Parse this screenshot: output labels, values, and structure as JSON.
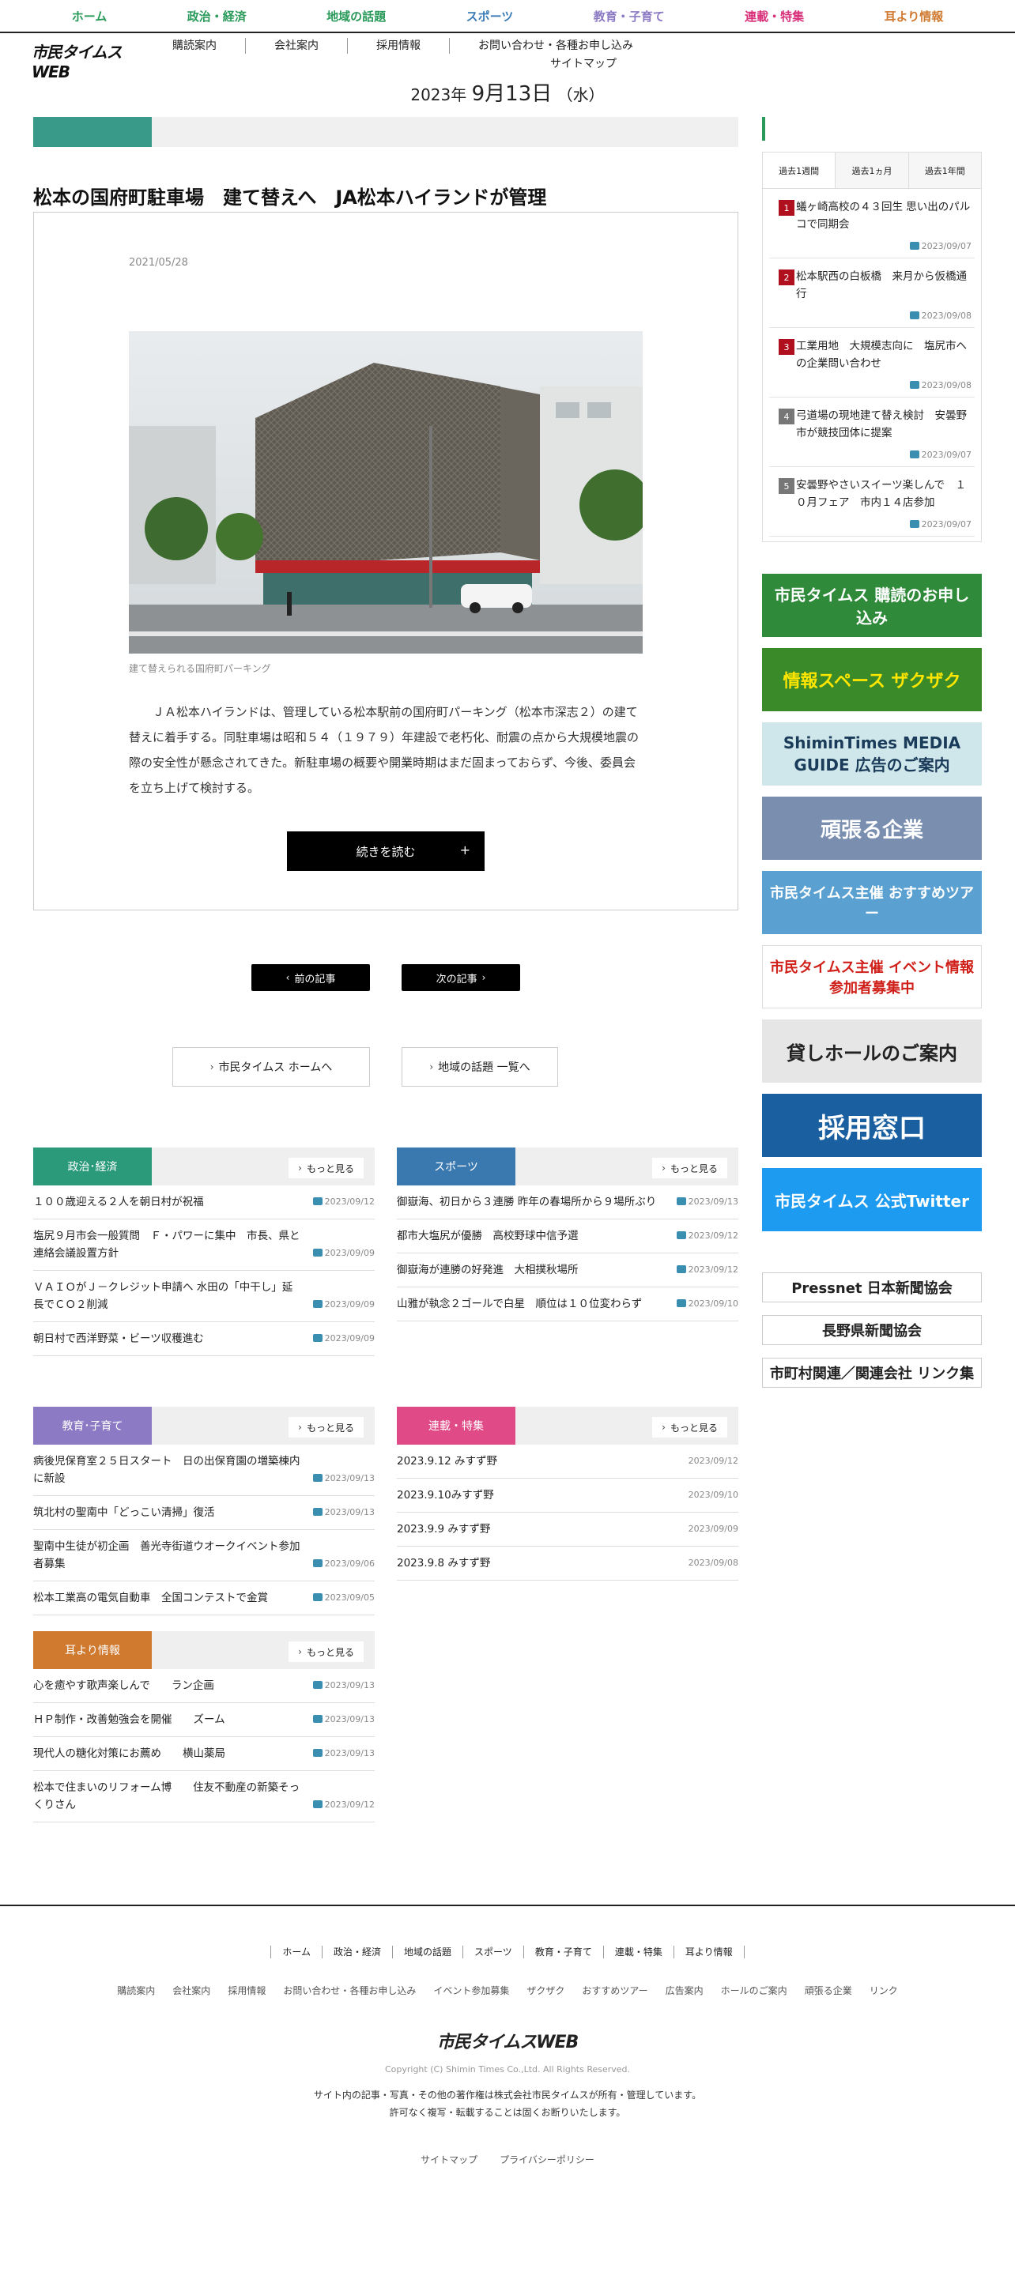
{
  "topnav": [
    {
      "label": "ホーム",
      "color": "#2a9a5a"
    },
    {
      "label": "政治・経済",
      "color": "#2a9a5a"
    },
    {
      "label": "地域の話題",
      "color": "#2a9a5a"
    },
    {
      "label": "スポーツ",
      "color": "#3a7ab5"
    },
    {
      "label": "教育・子育て",
      "color": "#8c7bc4"
    },
    {
      "label": "連載・特集",
      "color": "#d8307a"
    },
    {
      "label": "耳より情報",
      "color": "#d07a30"
    }
  ],
  "logo": "市民タイムスWEB",
  "subnav": [
    "購読案内",
    "会社案内",
    "採用情報",
    "お問い合わせ・各種お申し込み"
  ],
  "subnav2": "サイトマップ",
  "date": {
    "year": "2023",
    "year_suffix": "年",
    "md": "9月13日",
    "weekday": "（水）"
  },
  "article": {
    "title": "松本の国府町駐車場　建て替えへ　JA松本ハイランドが管理",
    "date": "2021/05/28",
    "caption": "建て替えられる国府町パーキング",
    "body": "ＪＡ松本ハイランドは、管理している松本駅前の国府町パーキング（松本市深志２）の建て替えに着手する。同駐車場は昭和５４（１９７９）年建設で老朽化、耐震の点から大規模地震の際の安全性が懸念されてきた。新駐車場の概要や開業時期はまだ固まっておらず、今後、委員会を立ち上げて検討する。",
    "more": "続きを読む"
  },
  "pager": {
    "prev": "前の記事",
    "next": "次の記事"
  },
  "links": {
    "home": "市民タイムス ホームへ",
    "list": "地域の話題 一覧へ"
  },
  "more_label": "もっと見る",
  "sections": {
    "politics": {
      "label": "政治･経済",
      "color": "#2a9a7a",
      "items": [
        {
          "title": "１００歳迎える２人を朝日村が祝福",
          "date": "2023/09/12",
          "cam": true
        },
        {
          "title": "塩尻９月市会一般質問　Ｆ・パワーに集中　市長、県と連絡会議設置方針",
          "date": "2023/09/09",
          "cam": true
        },
        {
          "title": "ＶＡＩＯがＪ－クレジット申請へ 水田の「中干し」延長でＣＯ２削減",
          "date": "2023/09/09",
          "cam": true
        },
        {
          "title": "朝日村で西洋野菜・ビーツ収穫進む",
          "date": "2023/09/09",
          "cam": true
        }
      ]
    },
    "sports": {
      "label": "スポーツ",
      "color": "#3a78b0",
      "items": [
        {
          "title": "御嶽海、初日から３連勝 昨年の春場所から９場所ぶり",
          "date": "2023/09/13",
          "cam": true
        },
        {
          "title": "都市大塩尻が優勝　高校野球中信予選",
          "date": "2023/09/12",
          "cam": true
        },
        {
          "title": "御嶽海が連勝の好発進　大相撲秋場所",
          "date": "2023/09/12",
          "cam": true
        },
        {
          "title": "山雅が執念２ゴールで白星　順位は１０位変わらず",
          "date": "2023/09/10",
          "cam": true
        }
      ]
    },
    "education": {
      "label": "教育･子育て",
      "color": "#8c7bc4",
      "items": [
        {
          "title": "病後児保育室２５日スタート　日の出保育園の増築棟内に新設",
          "date": "2023/09/13",
          "cam": true
        },
        {
          "title": "筑北村の聖南中「どっこい清掃」復活",
          "date": "2023/09/13",
          "cam": true
        },
        {
          "title": "聖南中生徒が初企画　善光寺街道ウオークイベント参加者募集",
          "date": "2023/09/06",
          "cam": true
        },
        {
          "title": "松本工業高の電気自動車　全国コンテストで金賞",
          "date": "2023/09/05",
          "cam": true
        }
      ]
    },
    "serial": {
      "label": "連載・特集",
      "color": "#e04a86",
      "items": [
        {
          "title": "2023.9.12 みすず野",
          "date": "2023/09/12",
          "cam": false
        },
        {
          "title": "2023.9.10みすず野",
          "date": "2023/09/10",
          "cam": false
        },
        {
          "title": "2023.9.9 みすず野",
          "date": "2023/09/09",
          "cam": false
        },
        {
          "title": "2023.9.8 みすず野",
          "date": "2023/09/08",
          "cam": false
        }
      ]
    },
    "info": {
      "label": "耳より情報",
      "color": "#d07a30",
      "items": [
        {
          "title": "心を癒やす歌声楽しんで　　ラン企画",
          "date": "2023/09/13",
          "cam": true
        },
        {
          "title": "ＨＰ制作・改善勉強会を開催　　ズーム",
          "date": "2023/09/13",
          "cam": true
        },
        {
          "title": "現代人の糖化対策にお薦め　　横山薬局",
          "date": "2023/09/13",
          "cam": true
        },
        {
          "title": "松本で住まいのリフォーム博　　住友不動産の新築そっくりさん",
          "date": "2023/09/12",
          "cam": true
        }
      ]
    }
  },
  "ranking": {
    "tabs": [
      "過去1週間",
      "過去1ヵ月",
      "過去1年間"
    ],
    "items": [
      {
        "num": "1",
        "title": "蟻ヶ崎高校の４３回生 思い出のパルコで同期会",
        "date": "2023/09/07",
        "color": "#b0101e"
      },
      {
        "num": "2",
        "title": "松本駅西の白板橋　来月から仮橋通行",
        "date": "2023/09/08",
        "color": "#b0101e"
      },
      {
        "num": "3",
        "title": "工業用地　大規模志向に　塩尻市への企業問い合わせ",
        "date": "2023/09/08",
        "color": "#b0101e"
      },
      {
        "num": "4",
        "title": "弓道場の現地建て替え検討　安曇野市が競技団体に提案",
        "date": "2023/09/07",
        "color": "#777777"
      },
      {
        "num": "5",
        "title": "安曇野やさいスイーツ楽しんで　１０月フェア　市内１４店参加",
        "date": "2023/09/07",
        "color": "#777777"
      }
    ]
  },
  "banners": [
    {
      "text": "市民タイムス 購読のお申し込み",
      "bg": "#2f8a3a",
      "fg": "#ffffff"
    },
    {
      "text": "情報スペース ザクザク",
      "bg": "#3a8a2a",
      "fg": "#ffe600"
    },
    {
      "text": "ShiminTimes MEDIA GUIDE 広告のご案内",
      "bg": "#cfe6ea",
      "fg": "#1a3c5a"
    },
    {
      "text": "頑張る企業",
      "bg": "#7a8fb0",
      "fg": "#ffffff"
    },
    {
      "text": "市民タイムス主催 おすすめツアー",
      "bg": "#5aa0d0",
      "fg": "#ffffff"
    },
    {
      "text": "市民タイムス主催 イベント情報 参加者募集中",
      "bg": "#ffffff",
      "fg": "#d0201a"
    },
    {
      "text": "貸しホールのご案内",
      "bg": "#e6e6e6",
      "fg": "#222222"
    },
    {
      "text": "採用窓口",
      "bg": "#1a5fa0",
      "fg": "#ffffff"
    },
    {
      "text": "市民タイムス 公式Twitter",
      "bg": "#1d9bf0",
      "fg": "#ffffff"
    }
  ],
  "small_banners": [
    "Pressnet 日本新聞協会",
    "長野県新聞協会",
    "市町村関連／関連会社 リンク集"
  ],
  "footer": {
    "nav": [
      "ホーム",
      "政治・経済",
      "地域の話題",
      "スポーツ",
      "教育・子育て",
      "連載・特集",
      "耳より情報"
    ],
    "nav2": [
      "購読案内",
      "会社案内",
      "採用情報",
      "お問い合わせ・各種お申し込み",
      "イベント参加募集",
      "ザクザク",
      "おすすめツアー",
      "広告案内",
      "ホールのご案内",
      "頑張る企業",
      "リンク"
    ],
    "logo": "市民タイムスWEB",
    "copyright": "Copyright (C) Shimin Times Co.,Ltd. All Rights Reserved.",
    "rights1": "サイト内の記事・写真・その他の著作権は株式会社市民タイムスが所有・管理しています。",
    "rights2": "許可なく複写・転載することは固くお断りいたします。",
    "bottom": [
      "サイトマップ",
      "プライバシーポリシー"
    ]
  }
}
